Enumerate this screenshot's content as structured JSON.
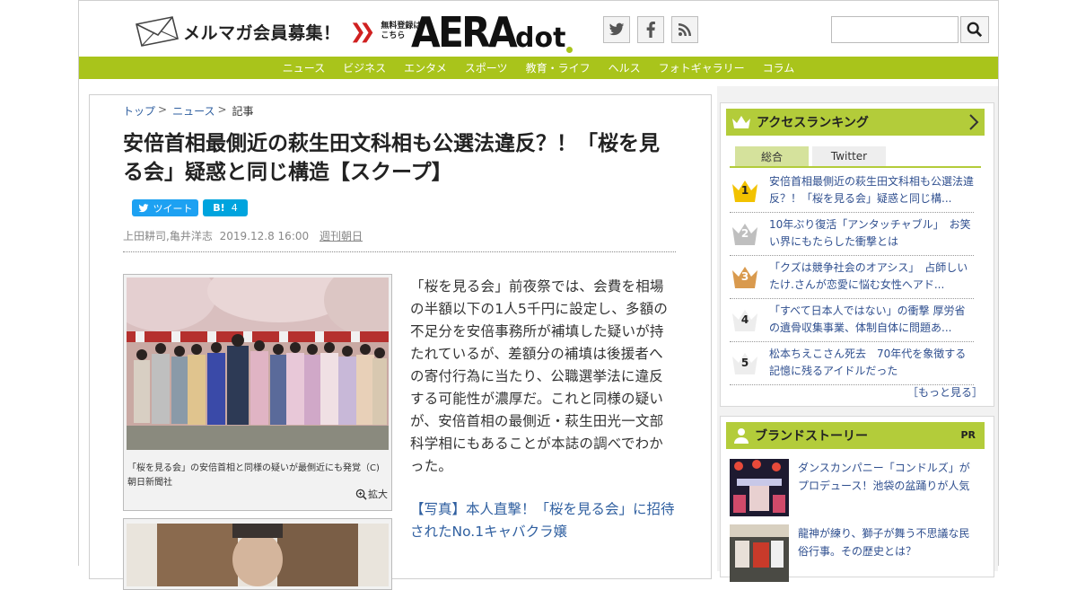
{
  "header": {
    "mail_banner": "メルマガ会員募集！",
    "mail_sub_line1": "無料登録は",
    "mail_sub_line2": "こちら",
    "logo_aera": "AERA",
    "logo_dot": "dot",
    "search": {
      "value": "",
      "placeholder": ""
    }
  },
  "nav": [
    "ニュース",
    "ビジネス",
    "エンタメ",
    "スポーツ",
    "教育・ライフ",
    "ヘルス",
    "フォトギャラリー",
    "コラム"
  ],
  "breadcrumb": {
    "top": "トップ",
    "news": "ニュース",
    "current": "記事"
  },
  "article": {
    "title": "安倍首相最側近の萩生田文科相も公選法違反？！「桜を見る会」疑惑と同じ構造【スクープ】",
    "tweet_label": "ツイート",
    "hatena_count": "4",
    "authors": "上田耕司,亀井洋志",
    "date": "2019.12.8 16:00",
    "source": "週刊朝日",
    "photo_caption": "「桜を見る会」の安倍首相と同様の疑いが最側近にも発覚（C)朝日新聞社",
    "zoom_label": "拡大",
    "body": "「桜を見る会」前夜祭では、会費を相場の半額以下の1人5千円に設定し、多額の不足分を安倍事務所が補填した疑いが持たれているが、差額分の補填は後援者への寄付行為に当たり、公職選挙法に違反する可能性が濃厚だ。これと同様の疑いが、安倍首相の最側近・萩生田光一文部科学相にもあることが本誌の調べでわかった。",
    "related_link": "【写真】本人直撃！「桜を見る会」に招待されたNo.1キャバクラ嬢"
  },
  "ranking": {
    "title": "アクセスランキング",
    "tabs": [
      "総合",
      "Twitter"
    ],
    "active_tab": "総合",
    "items": [
      {
        "rank": "1",
        "title": "安倍首相最側近の萩生田文科相も公選法違反？！「桜を見る会」疑惑と同じ構...",
        "crown": "#f2c200"
      },
      {
        "rank": "2",
        "title": "10年ぶり復活「アンタッチャブル」　お笑い界にもたらした衝撃とは",
        "crown": "#bfbfbf"
      },
      {
        "rank": "3",
        "title": "「クズは競争社会のオアシス」　占師しいたけ.さんが恋愛に悩む女性へアド...",
        "crown": "#d99a4e"
      },
      {
        "rank": "4",
        "title": "「すべて日本人ではない」の衝撃 厚労省の遺骨収集事業、体制自体に問題あ...",
        "crown": "#ededed"
      },
      {
        "rank": "5",
        "title": "松本ちえこさん死去　70年代を象徴する記憶に残るアイドルだった",
        "crown": "#ededed"
      }
    ],
    "more": "［もっと見る］"
  },
  "brand": {
    "title": "ブランドストーリー",
    "pr": "PR",
    "items": [
      {
        "title": "ダンスカンパニー「コンドルズ」がプロデュース！池袋の盆踊りが人気"
      },
      {
        "title": "龍神が練り、獅子が舞う不思議な民俗行事。その歴史とは？"
      }
    ]
  },
  "colors": {
    "accent": "#a9c41b",
    "panel_head": "#b3cc3a",
    "link": "#2f5fa0",
    "twitter": "#1da1f2",
    "hatena": "#00a4de",
    "mail_arrow": "#d02020"
  }
}
